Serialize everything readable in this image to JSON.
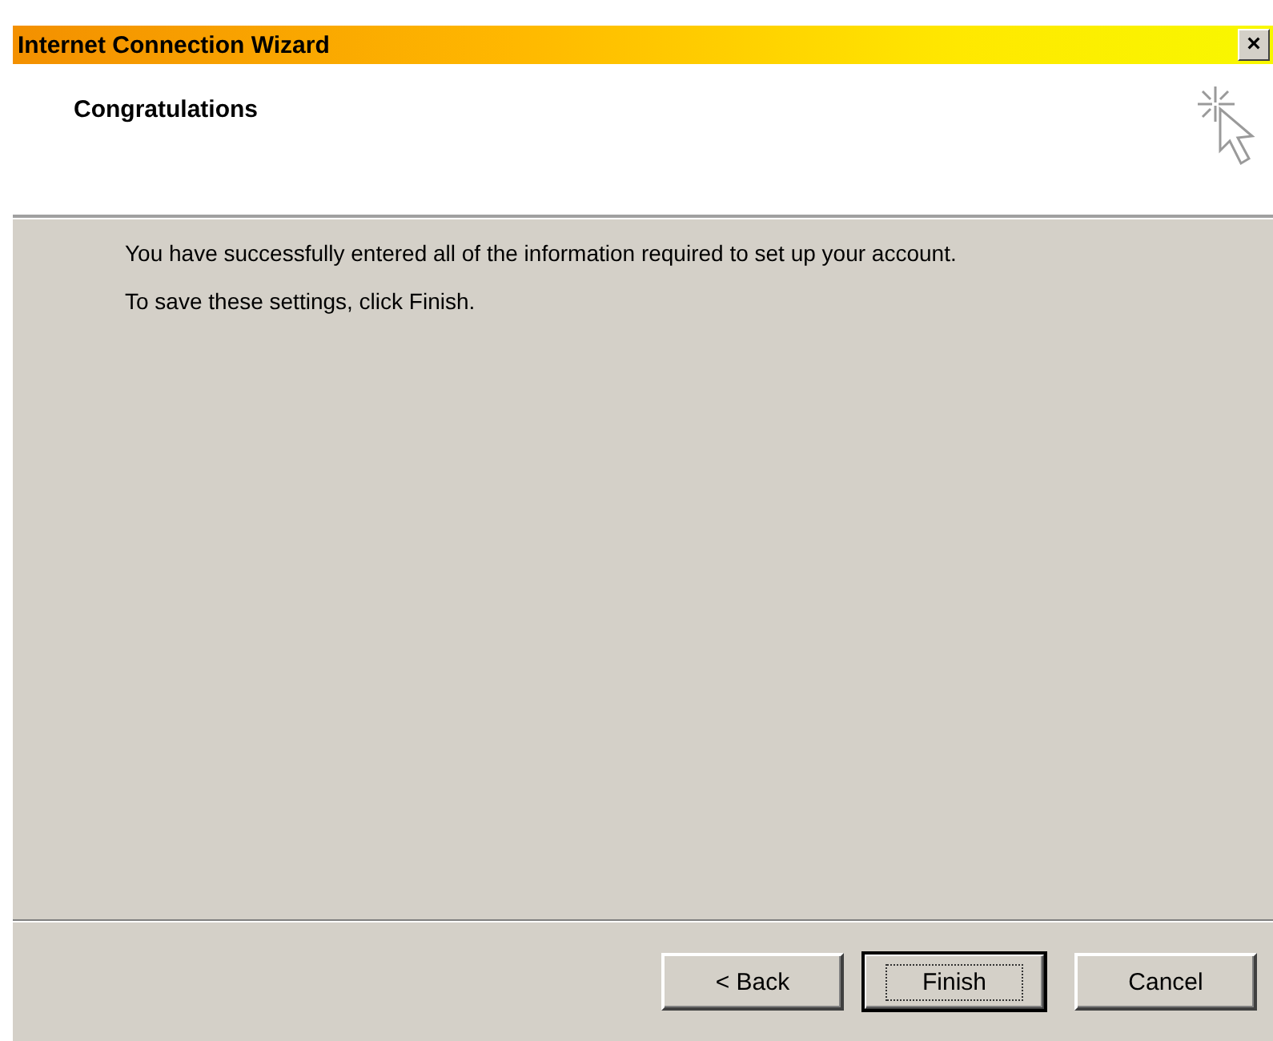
{
  "window": {
    "title": "Internet Connection Wizard",
    "close": "×"
  },
  "header": {
    "title": "Congratulations"
  },
  "body": {
    "paragraphs": [
      "You have successfully entered all of the information required to set up your account.",
      "To save these settings, click Finish."
    ]
  },
  "buttons": [
    {
      "label": "< Back",
      "default": false
    },
    {
      "label": "Finish",
      "default": true
    },
    {
      "label": "Cancel",
      "default": false
    }
  ]
}
